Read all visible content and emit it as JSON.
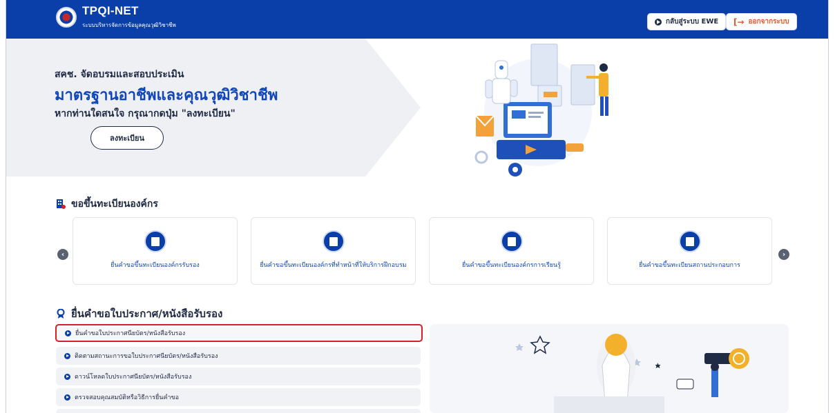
{
  "header": {
    "brand_title": "TPQI-NET",
    "brand_subtitle": "ระบบบริหารจัดการข้อมูลคุณวุฒิวิชาชีพ",
    "back_button_label": "กลับสู่ระบบ EWE",
    "logout_button_label": "ออกจากระบบ",
    "logout_icon": "logout-arrow-icon",
    "colors": {
      "bar": "#0a3ea8",
      "logout": "#e4572e"
    }
  },
  "hero": {
    "line1": "สคช. จัดอบรมและสอบประเมิน",
    "line2": "มาตรฐานอาชีพและคุณวุฒิวิชาชีพ",
    "line3": "หากท่านใดสนใจ กรุณากดปุ่ม \"ลงทะเบียน\"",
    "register_label": "ลงทะเบียน"
  },
  "org_section": {
    "title": "ขอขึ้นทะเบียนองค์กร",
    "cards": [
      {
        "label": "ยื่นคำขอขึ้นทะเบียนองค์กรรับรอง"
      },
      {
        "label": "ยื่นคำขอขึ้นทะเบียนองค์กรที่ทำหน้าที่ให้บริการฝึกอบรม"
      },
      {
        "label": "ยื่นคำขอขึ้นทะเบียนองค์กรการเรียนรู้"
      },
      {
        "label": "ยื่นคำขอขึ้นทะเบียนสถานประกอบการ"
      }
    ]
  },
  "cert_section": {
    "title": "ยื่นคำขอใบประกาศ/หนังสือรับรอง",
    "links": [
      {
        "label": "ยื่นคำขอใบประกาศนียบัตร/หนังสือรับรอง",
        "selected": true
      },
      {
        "label": "ติดตามสถานะการขอใบประกาศนียบัตร/หนังสือรับรอง"
      },
      {
        "label": "ดาวน์โหลดใบประกาศนียบัตร/หนังสือรับรอง"
      },
      {
        "label": "ตรวจสอบคุณสมบัติหรือวิธีการยื่นคำขอ"
      }
    ],
    "highlight_color": "#d91f26"
  }
}
